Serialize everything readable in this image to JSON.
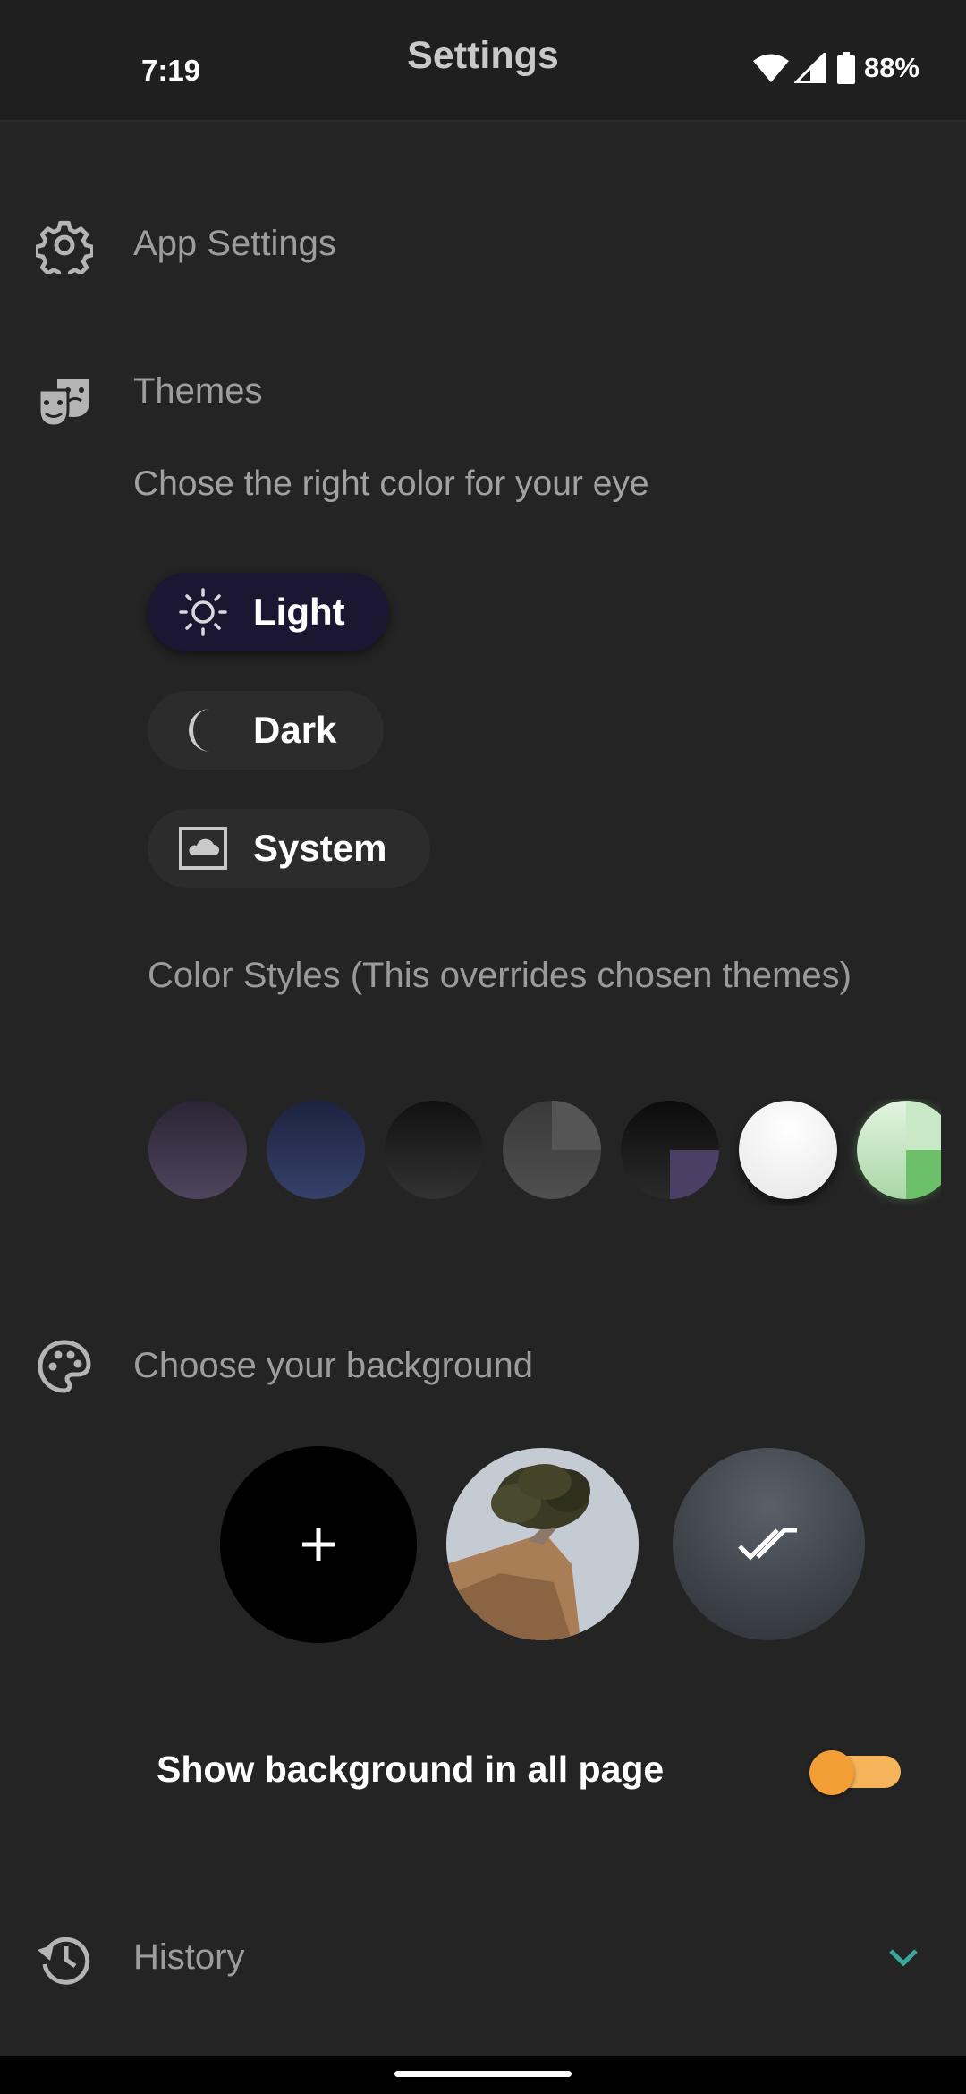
{
  "status_bar": {
    "time": "7:19",
    "battery": "88%"
  },
  "app_bar": {
    "title": "Settings"
  },
  "app_settings": {
    "title": "App Settings",
    "icon": "gear-icon"
  },
  "themes": {
    "title": "Themes",
    "icon": "theater-masks-icon",
    "subtitle": "Chose the right color for your eye",
    "options": [
      {
        "label": "Light",
        "icon": "sun-icon",
        "selected": true
      },
      {
        "label": "Dark",
        "icon": "moon-icon",
        "selected": false
      },
      {
        "label": "System",
        "icon": "monitor-cloud-icon",
        "selected": false
      }
    ]
  },
  "color_styles": {
    "title": "Color Styles (This overrides chosen themes)",
    "swatches": [
      "#4a4258",
      "#2f3a5c",
      "#262626",
      "#4a4a4a",
      "#1e1e1e",
      "#ffffff",
      "#a8d7a5"
    ]
  },
  "background": {
    "title": "Choose your background",
    "icon": "palette-icon",
    "options": [
      {
        "name": "add-background",
        "icon": "plus-icon"
      },
      {
        "name": "tree-photo"
      },
      {
        "name": "night-sky",
        "selected": true,
        "icon": "double-check-icon"
      }
    ],
    "toggle_label": "Show background in all page",
    "toggle_on": true
  },
  "history": {
    "title": "History",
    "icon": "history-icon",
    "expand_icon": "chevron-down-icon"
  },
  "colors": {
    "accent": "#f29e35",
    "chevron": "#3aa79a",
    "selected_pill": "#1b1733"
  }
}
